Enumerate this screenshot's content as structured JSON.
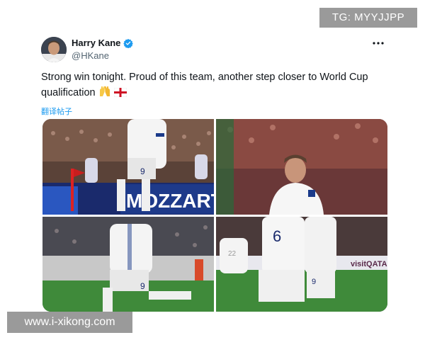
{
  "watermarks": {
    "top_right": "TG: MYYJJPP",
    "bottom_left": "www.i-xikong.com"
  },
  "tweet": {
    "author_name": "Harry Kane",
    "handle": "@HKane",
    "verified": true,
    "text": "Strong win tonight. Proud of this team, another step closer to World Cup qualification",
    "emojis": [
      "raised-hands-emoji",
      "england-flag-emoji"
    ],
    "translate_label": "翻译帖子",
    "more_icon": "ellipsis-icon"
  },
  "media": {
    "photo_count": 4,
    "photo_1": {
      "banner_text": "MOZZART",
      "jersey_number": "9"
    },
    "photo_2": {
      "jersey_number": ""
    },
    "photo_3": {
      "jersey_number": "9"
    },
    "photo_4": {
      "jersey_numbers": [
        "6",
        "9",
        "22"
      ],
      "banner_text": "visitQATAR"
    }
  },
  "colors": {
    "link_blue": "#1d9bf0",
    "verified_blue": "#1d9bf0",
    "handle_gray": "#536471",
    "watermark_gray": "#9a9a9a"
  }
}
